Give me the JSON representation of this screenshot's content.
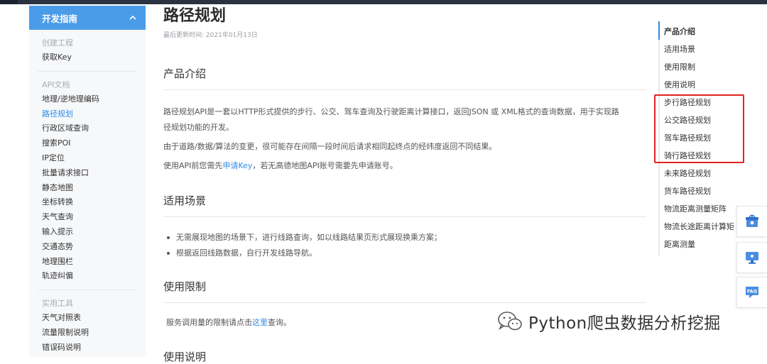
{
  "sidebar": {
    "header": "开发指南",
    "groups": [
      {
        "title": "",
        "items": [
          "创建工程",
          "获取Key"
        ]
      },
      {
        "title": "API文档",
        "items": [
          "地理/逆地理编码",
          "路径规划",
          "行政区域查询",
          "搜索POI",
          "IP定位",
          "批量请求接口",
          "静态地图",
          "坐标转换",
          "天气查询",
          "输入提示",
          "交通态势",
          "地理围栏",
          "轨迹纠偏"
        ]
      },
      {
        "title": "实用工具",
        "items": [
          "天气对照表",
          "流量限制说明",
          "错误码说明"
        ]
      }
    ],
    "create_project": "创建工程",
    "get_key": "获取Key",
    "api_docs": "API文档",
    "api_items": [
      "地理/逆地理编码",
      "路径规划",
      "行政区域查询",
      "搜索POI",
      "IP定位",
      "批量请求接口",
      "静态地图",
      "坐标转换",
      "天气查询",
      "输入提示",
      "交通态势",
      "地理围栏",
      "轨迹纠偏"
    ],
    "tools": "实用工具",
    "tool_items": [
      "天气对照表",
      "流量限制说明",
      "错误码说明"
    ],
    "active_item": "路径规划"
  },
  "main": {
    "title": "路径规划",
    "updated": "最后更新时间: 2021年01月13日",
    "sec_intro": "产品介绍",
    "intro_p1_line1": "路径规划API是一套以HTTP形式提供的步行、公交、驾车查询及行驶距离计算接口，返回JSON 或 XML格式的查询数据，用于实现路",
    "intro_p1_line2": "径规划功能的开发。",
    "intro_p2": "由于道路/数据/算法的变更，很可能存在间隔一段时间后请求相同起终点的经纬度返回不同结果。",
    "intro_p3_pre": "使用API前您需先",
    "intro_p3_link": "申请Key",
    "intro_p3_post": "，若无高德地图API账号需要先申请账号。",
    "sec_scene": "适用场景",
    "scene_b1": "无需展现地图的场景下，进行线路查询，如以线路结果页形式展现换乘方案；",
    "scene_b2": "根据返回线路数据，自行开发线路导航。",
    "sec_limit": "使用限制",
    "limit_pre": "服务调用量的限制请点击",
    "limit_link": "这里",
    "limit_post": "查询。",
    "sec_usage": "使用说明"
  },
  "toc": {
    "items": [
      "产品介绍",
      "适用场景",
      "使用限制",
      "使用说明",
      "步行路径规划",
      "公交路径规划",
      "驾车路径规划",
      "骑行路径规划",
      "未来路径规划",
      "货车路径规划",
      "物流距离测量矩阵",
      "物流长途距离计算矩",
      "距离测量"
    ]
  },
  "float_tools": {
    "faq_label": "FAQ"
  },
  "watermark": {
    "text": "Python爬虫数据分析挖掘"
  },
  "colors": {
    "accent": "#4a9ce8",
    "link": "#2f8be6",
    "highlight": "#e02424"
  }
}
